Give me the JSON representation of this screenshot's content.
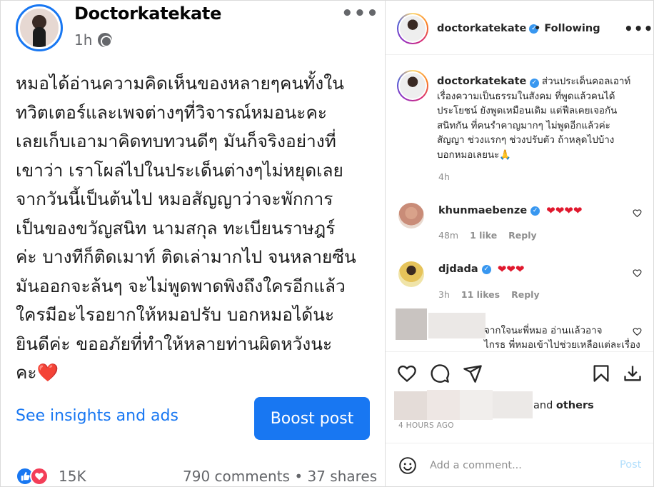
{
  "facebook": {
    "author": "Doctorkatekate",
    "time": "1h",
    "body_lines": [
      "หมอได้อ่านความคิดเห็นของหลายๆคนทั้งใน",
      "ทวิตเตอร์และเพจต่างๆที่วิจารณ์หมอนะคะ",
      "เลยเก็บเอามาคิดทบทวนดีๆ มันก็จริงอย่างที่",
      "เขาว่า เราโผล่ไปในประเด็นต่างๆไม่หยุดเลย",
      "จากวันนี้เป็นต้นไป หมอสัญญาว่าจะพักการ",
      "เป็นของขวัญสนิท นามสกุล ทะเบียนราษฎร์",
      "ค่ะ บางทีก็ติดเมาท์ ติดเล่ามากไป จนหลายซีน",
      "มันออกจะล้นๆ จะไม่พูดพาดพิงถึงใครอีกแล้ว",
      "ใครมีอะไรอยากให้หมอปรับ บอกหมอได้นะ",
      "ยินดีค่ะ ขออภัยที่ทำให้หลายท่านผิดหวังนะ",
      "คะ"
    ],
    "body_end_emoji": "❤️",
    "see_insights_label": "See insights and ads",
    "boost_label": "Boost post",
    "reaction_count": "15K",
    "comments_shares": "790 comments • 37 shares",
    "accent_color": "#1877f2"
  },
  "instagram": {
    "header": {
      "username": "doctorkatekate",
      "separator": "•",
      "following_label": "Following"
    },
    "caption": {
      "username": "doctorkatekate",
      "lines": [
        "ส่วนประเด็นคอลเอาท์",
        "เรื่องความเป็นธรรมในสังคม ที่พูดแล้วคนได้",
        "ประโยชน์ ยังพูดเหมือนเดิม แต่ฟีลเคยเจอกัน",
        "สนิทกัน ที่คนรำคาญมากๆ ไม่พูดอีกแล้วค่ะ",
        "สัญญา ช่วงแรกๆ ช่วงปรับตัว ถ้าหลุดไปบ้าง",
        "บอกหมอเลยนะ🙏"
      ],
      "time": "4h"
    },
    "comments": [
      {
        "username": "khunmaebenze",
        "text": "❤❤❤❤",
        "time": "48m",
        "likes": "1 like",
        "reply_label": "Reply"
      },
      {
        "username": "djdada",
        "text": "❤❤❤",
        "time": "3h",
        "likes": "11 likes",
        "reply_label": "Reply"
      }
    ],
    "partial_comment_lines": [
      "จากใจนะพี่หมอ อ่านแล้วอาจ",
      "ไกรธ พี่หมอเข้าไปช่วยเหลือแต่ละเรื่อง"
    ],
    "liked_by_suffix": "and",
    "liked_by_others": "others",
    "post_time": "4 HOURS AGO",
    "add_comment_placeholder": "Add a comment...",
    "post_label": "Post",
    "icons": [
      "heart-icon",
      "comment-icon",
      "share-icon",
      "bookmark-icon",
      "download-icon",
      "smile-icon"
    ]
  }
}
